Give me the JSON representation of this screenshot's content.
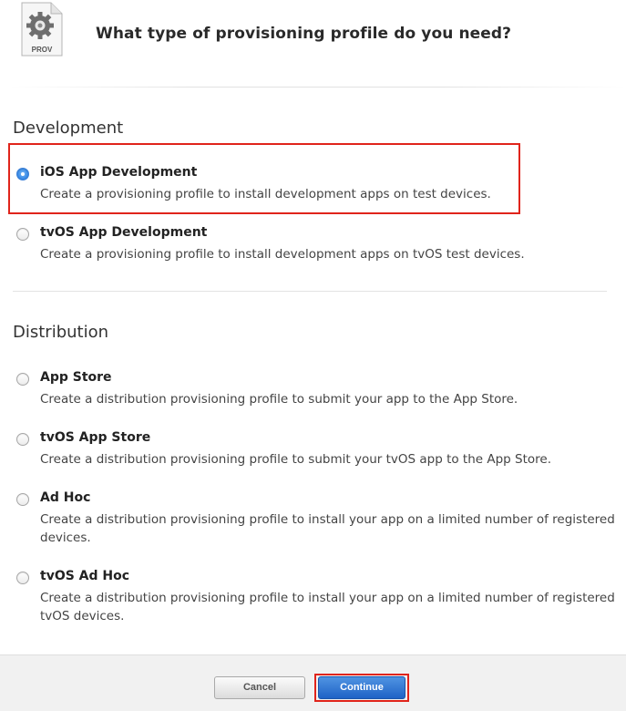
{
  "header": {
    "icon_label": "PROV",
    "title": "What type of provisioning profile do you need?"
  },
  "development": {
    "section_title": "Development",
    "options": [
      {
        "label": "iOS App Development",
        "description": "Create a provisioning profile to install development apps on test devices.",
        "selected": true
      },
      {
        "label": "tvOS App Development",
        "description": "Create a provisioning profile to install development apps on tvOS test devices.",
        "selected": false
      }
    ]
  },
  "distribution": {
    "section_title": "Distribution",
    "options": [
      {
        "label": "App Store",
        "description": "Create a distribution provisioning profile to submit your app to the App Store.",
        "selected": false
      },
      {
        "label": "tvOS App Store",
        "description": "Create a distribution provisioning profile to submit your tvOS app to the App Store.",
        "selected": false
      },
      {
        "label": "Ad Hoc",
        "description": "Create a distribution provisioning profile to install your app on a limited number of registered devices.",
        "selected": false
      },
      {
        "label": "tvOS Ad Hoc",
        "description": "Create a distribution provisioning profile to install your app on a limited number of registered tvOS devices.",
        "selected": false
      }
    ]
  },
  "footer": {
    "cancel_label": "Cancel",
    "continue_label": "Continue"
  },
  "colors": {
    "accent_blue": "#2a72cf",
    "highlight_red": "#e0241b"
  }
}
